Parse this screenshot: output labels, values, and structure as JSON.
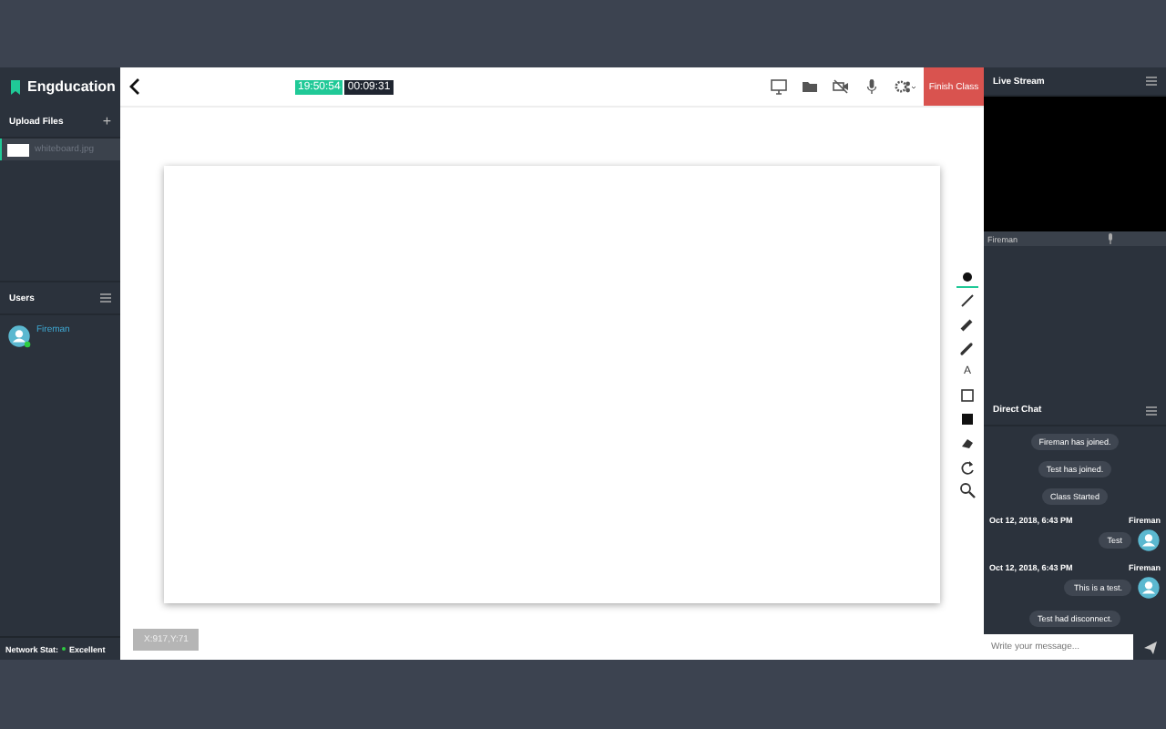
{
  "brand": {
    "name": "Engducation"
  },
  "upload": {
    "title": "Upload Files",
    "add": "+",
    "files": [
      {
        "name": "whiteboard.jpg",
        "selected": true
      }
    ]
  },
  "users": {
    "title": "Users",
    "list": [
      {
        "name": "Fireman",
        "online": true
      }
    ]
  },
  "network": {
    "label": "Network Stat:",
    "status": "Excellent",
    "color": "#2ecc40"
  },
  "toolbar": {
    "clock": "19:50:54",
    "timer": "00:09:31",
    "finish": "Finish Class"
  },
  "tools": [
    {
      "kind": "dot",
      "selected": true
    },
    {
      "kind": "pencil",
      "selected": false
    },
    {
      "kind": "marker",
      "selected": false
    },
    {
      "kind": "brush",
      "selected": false
    },
    {
      "kind": "text",
      "label": "A",
      "selected": false
    },
    {
      "kind": "square",
      "selected": false
    },
    {
      "kind": "filled-square",
      "selected": false
    },
    {
      "kind": "eraser",
      "selected": false
    },
    {
      "kind": "redo",
      "selected": false
    },
    {
      "kind": "zoom",
      "selected": false
    }
  ],
  "coords": "X:917,Y:71",
  "stream": {
    "title": "Live Stream",
    "name": "Fireman"
  },
  "chat": {
    "title": "Direct Chat",
    "placeholder": "Write your message...",
    "messages": [
      {
        "kind": "system",
        "text": "Fireman has joined."
      },
      {
        "kind": "system",
        "text": "Test has joined."
      },
      {
        "kind": "system",
        "text": "Class Started"
      },
      {
        "kind": "user",
        "date": "Oct 12, 2018, 6:43 PM",
        "author": "Fireman",
        "text": "Test"
      },
      {
        "kind": "user",
        "date": "Oct 12, 2018, 6:43 PM",
        "author": "Fireman",
        "text": "This is a test."
      },
      {
        "kind": "system",
        "text": "Test had disconnect."
      }
    ]
  }
}
